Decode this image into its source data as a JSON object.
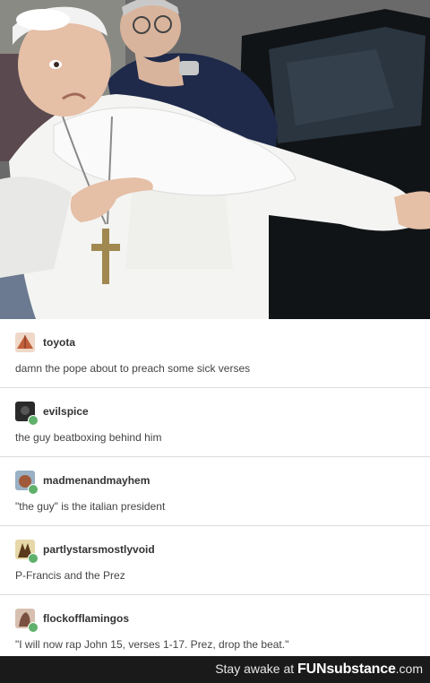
{
  "posts": [
    {
      "username": "toyota",
      "text": "damn the pope about to preach some sick verses",
      "avatar_color": "#c0603b"
    },
    {
      "username": "evilspice",
      "text": "the guy beatboxing behind him",
      "avatar_color": "#3a3a3a"
    },
    {
      "username": "madmenandmayhem",
      "text": "\"the guy\" is the italian president",
      "avatar_color": "#5a7fa0"
    },
    {
      "username": "partlystarsmostlyvoid",
      "text": "P-Francis and the Prez",
      "avatar_color": "#7a5a2a"
    },
    {
      "username": "flockofflamingos",
      "text": "\"I will now rap John 15, verses 1-17. Prez, drop the beat.\"",
      "avatar_color": "#8a6a5a"
    }
  ],
  "footer": {
    "tagline": "Stay awake at ",
    "brand": "FUNsubstance",
    "domain": ".com"
  },
  "colors": {
    "badge": "#5fb06b",
    "footer_bg": "#1a1a1a"
  }
}
